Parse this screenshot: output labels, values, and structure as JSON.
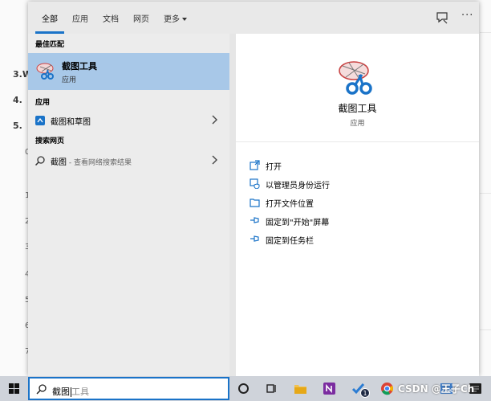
{
  "background": {
    "items": [
      "3.W",
      "4.",
      "5."
    ],
    "numbers": [
      "0",
      "1",
      "2",
      "3",
      "4",
      "5",
      "6",
      "7"
    ]
  },
  "tabs": [
    {
      "label": "全部",
      "active": true
    },
    {
      "label": "应用"
    },
    {
      "label": "文档"
    },
    {
      "label": "网页"
    },
    {
      "label": "更多"
    }
  ],
  "top_icons": {
    "feedback": "feedback-icon",
    "more": "···"
  },
  "results": {
    "best_match_header": "最佳匹配",
    "best_match": {
      "title": "截图工具",
      "subtitle": "应用",
      "icon": "snipping-tool-icon"
    },
    "apps_header": "应用",
    "apps": [
      {
        "label": "截图和草图",
        "icon": "snip-sketch-icon"
      }
    ],
    "web_header": "搜索网页",
    "web": [
      {
        "query": "截图",
        "hint": " - 查看网络搜索结果",
        "icon": "search-icon"
      }
    ]
  },
  "detail": {
    "title": "截图工具",
    "subtitle": "应用",
    "actions": [
      {
        "label": "打开",
        "icon": "open-icon"
      },
      {
        "label": "以管理员身份运行",
        "icon": "shield-icon"
      },
      {
        "label": "打开文件位置",
        "icon": "folder-icon"
      },
      {
        "label": "固定到\"开始\"屏幕",
        "icon": "pin-icon"
      },
      {
        "label": "固定到任务栏",
        "icon": "pin-icon"
      }
    ]
  },
  "taskbar": {
    "search_typed": "截图",
    "search_autocomplete": "工具",
    "badge_count": "1",
    "watermark": "CSDN @王子Ch"
  },
  "colors": {
    "accent": "#1a73c8",
    "selection": "#a8c8e8",
    "panel": "#e6e6e6",
    "taskbar": "#cfd3da"
  }
}
